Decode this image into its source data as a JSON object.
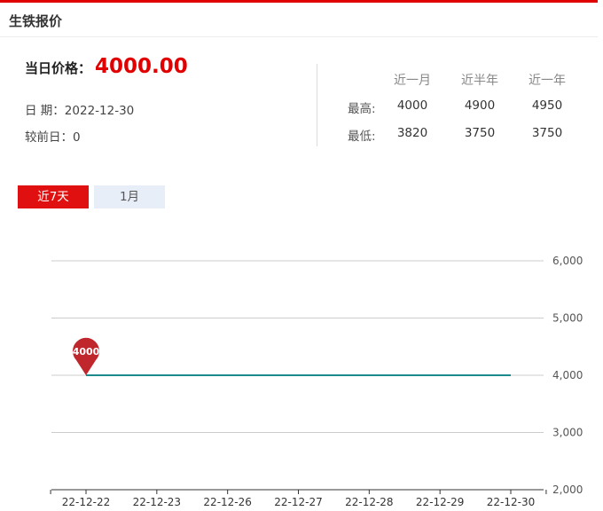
{
  "header": {
    "title": "生铁报价"
  },
  "price": {
    "label": "当日价格：",
    "value": "4000.00"
  },
  "info": {
    "date_label": "日 期：",
    "date_value": "2022-12-30",
    "change_label": "较前日：",
    "change_value": "0"
  },
  "stats": {
    "columns": [
      "近一月",
      "近半年",
      "近一年"
    ],
    "rows": [
      {
        "label": "最高:",
        "values": [
          "4000",
          "4900",
          "4950"
        ]
      },
      {
        "label": "最低:",
        "values": [
          "3820",
          "3750",
          "3750"
        ]
      }
    ]
  },
  "tabs": [
    {
      "label": "近7天",
      "active": true
    },
    {
      "label": "1月",
      "active": false
    }
  ],
  "colors": {
    "accent": "#e00000",
    "line": "#1a8a8a",
    "marker": "#c0272d"
  },
  "chart_data": {
    "type": "line",
    "x": [
      "22-12-22",
      "22-12-23",
      "22-12-26",
      "22-12-27",
      "22-12-28",
      "22-12-29",
      "22-12-30"
    ],
    "series": [
      {
        "values": [
          4000,
          4000,
          4000,
          4000,
          4000,
          4000,
          4000
        ]
      }
    ],
    "ylim": [
      2000,
      6000
    ],
    "yticks": [
      "2,000",
      "3,000",
      "4,000",
      "5,000",
      "6,000"
    ],
    "ytick_values": [
      2000,
      3000,
      4000,
      5000,
      6000
    ],
    "grid": true,
    "y_axis_side": "right",
    "marker": {
      "index": 0,
      "label": "4000"
    }
  }
}
